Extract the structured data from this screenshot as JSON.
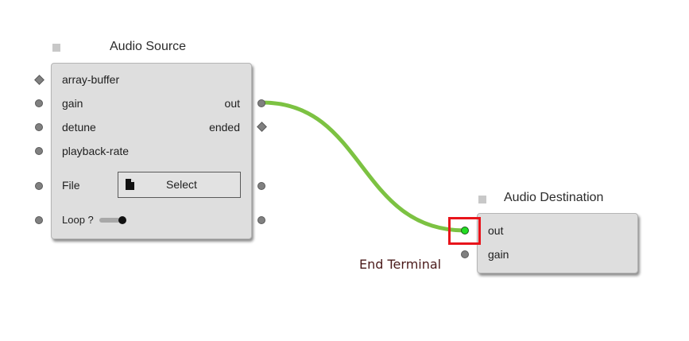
{
  "nodes": {
    "audio_source": {
      "title": "Audio Source",
      "inputs": [
        "array-buffer",
        "gain",
        "detune",
        "playback-rate"
      ],
      "outputs": [
        "out",
        "ended"
      ],
      "file_label": "File",
      "select_label": "Select",
      "loop_label": "Loop ?",
      "loop_enabled": true
    },
    "audio_destination": {
      "title": "Audio Destination",
      "inputs": [
        "out",
        "gain"
      ]
    }
  },
  "connection": {
    "color": "#7cc242",
    "active_terminal_color": "#22dd22"
  },
  "annotation": {
    "label": "End Terminal",
    "box_color": "#e8141b"
  }
}
